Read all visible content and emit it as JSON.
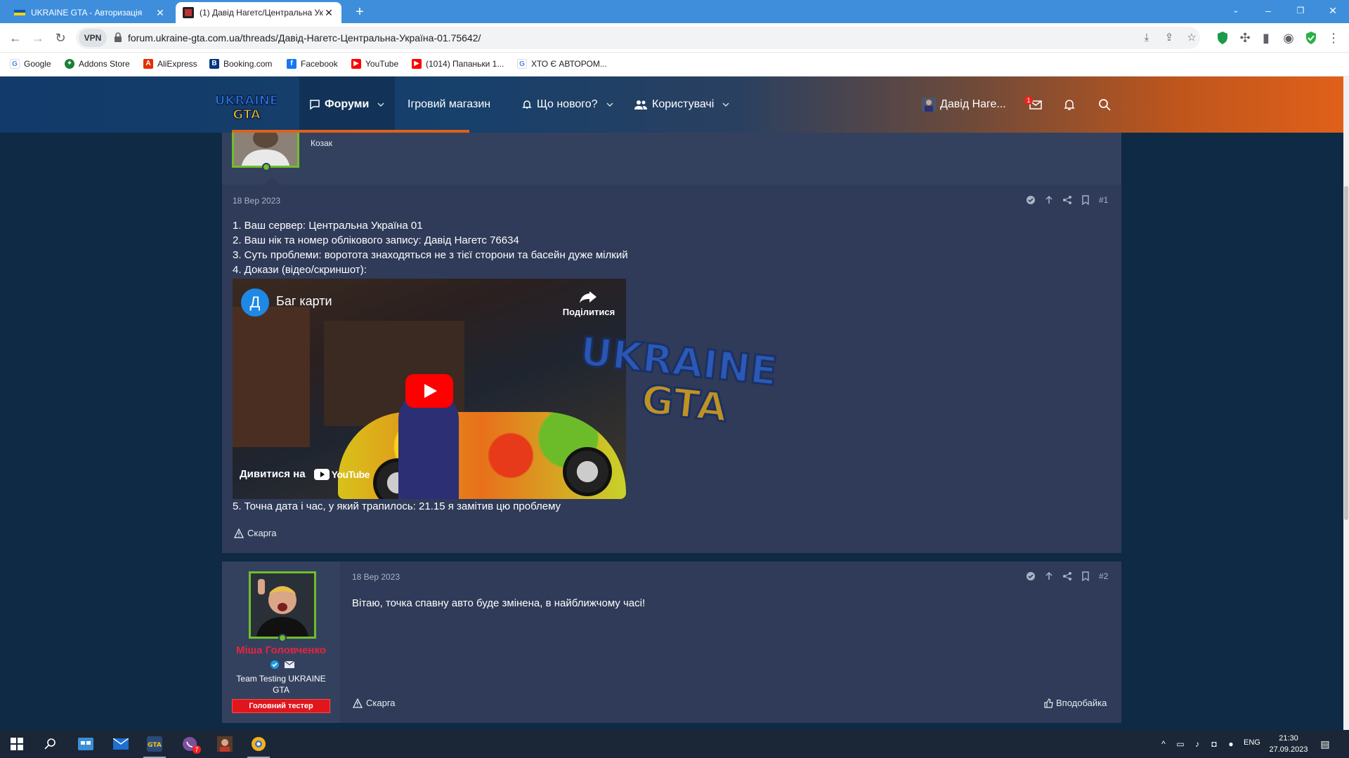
{
  "browser": {
    "tabs": [
      {
        "title": "UKRAINE GTA - Авторизація",
        "active": false
      },
      {
        "title": "(1) Давід Нагетс/Центральна Ук",
        "active": true
      }
    ],
    "url": "forum.ukraine-gta.com.ua/threads/Давід-Нагетс-Центральна-Україна-01.75642/",
    "vpn_label": "VPN",
    "bookmarks": [
      {
        "label": "Google",
        "icon": "google-icon",
        "color": "#4285f4"
      },
      {
        "label": "Addons Store",
        "icon": "addons-store-icon",
        "color": "#1a7f37"
      },
      {
        "label": "AliExpress",
        "icon": "aliexpress-icon",
        "color": "#e62e04"
      },
      {
        "label": "Booking.com",
        "icon": "booking-icon",
        "color": "#003580"
      },
      {
        "label": "Facebook",
        "icon": "facebook-icon",
        "color": "#1877f2"
      },
      {
        "label": "YouTube",
        "icon": "youtube-icon",
        "color": "#ff0000"
      },
      {
        "label": "(1014) Папаньки 1...",
        "icon": "youtube-icon",
        "color": "#ff0000"
      },
      {
        "label": "ХТО Є АВТОРОМ...",
        "icon": "google-icon",
        "color": "#4285f4"
      }
    ]
  },
  "site": {
    "logo_text": "UKRAINE GTA",
    "nav": {
      "forums": "Форуми",
      "store": "Ігровий магазин",
      "whats_new": "Що нового?",
      "users": "Користувачі"
    },
    "account_name": "Давід Наге...",
    "inbox_badge": "1",
    "colors": {
      "accent": "#e0601a",
      "header_dark": "#123a6a",
      "post_bg": "#2f3b58",
      "online": "#6fbf2a"
    }
  },
  "post1": {
    "author_title": "Козак",
    "date": "18 Вер 2023",
    "number": "#1",
    "lines": [
      "1. Ваш сервер: Центральна Україна 01",
      "2. Ваш нік та номер облікового запису: Давід Нагетс 76634",
      "3. Суть проблеми: воротота знаходяться не з тієї сторони та басейн дуже мілкий",
      "4. Докази (відео/скриншот):"
    ],
    "video": {
      "channel_initial": "Д",
      "title": "Баг карти",
      "share_label": "Поділитися",
      "watch_on": "Дивитися на",
      "youtube_label": "YouTube"
    },
    "line5": "5. Точна дата і час, у який трапилось: 21.15 я замітив цю проблему",
    "report_label": "Скарга"
  },
  "post2": {
    "username": "Міша Головченко",
    "user_title": "Team Testing UKRAINE GTA",
    "banner": "Головний тестер",
    "date": "18 Вер 2023",
    "number": "#2",
    "body": "Вітаю, точка спавну авто буде змінена, в найближчому часі!",
    "report_label": "Скарга",
    "like_label": "Вподобайка"
  },
  "taskbar": {
    "lang": "ENG",
    "time": "21:30",
    "date": "27.09.2023",
    "viber_badge": "7"
  }
}
